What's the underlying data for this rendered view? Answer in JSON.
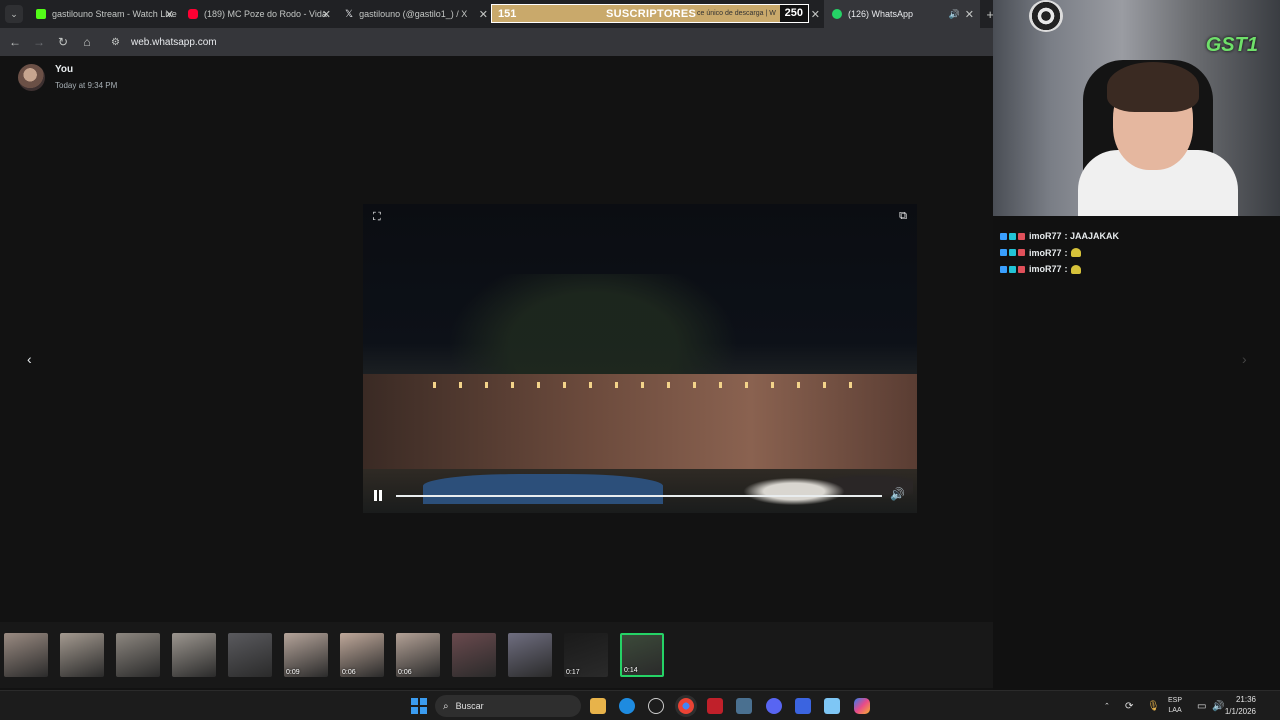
{
  "tabs": [
    {
      "title": "gastilouno Stream - Watch Live",
      "fav_color": "#53fc18",
      "active": false
    },
    {
      "title": "(189) MC Poze do Rodo - Vida",
      "fav_color": "#ff0033",
      "active": false
    },
    {
      "title": "gastilouno (@gastilo1_) / X",
      "fav_color": "#000000",
      "active": false
    },
    {
      "title": "Mensaje único de descarga | WhatsApp",
      "active": false
    },
    {
      "title": "(126) WhatsApp",
      "fav_color": "#25d366",
      "active": true
    }
  ],
  "overlay": {
    "current": "151",
    "label": "SUSCRIPTORES",
    "goal": "250",
    "under_text": "ce único de descarga | W"
  },
  "address": {
    "url": "web.whatsapp.com"
  },
  "viewer": {
    "sender_name": "You",
    "sender_time": "Today at 9:34 PM",
    "prev_label": "‹",
    "next_label": "›",
    "progress": 0.0
  },
  "thumbnails": [
    {
      "duration": "",
      "kind": "image",
      "color": "#9a8b82"
    },
    {
      "duration": "",
      "kind": "image",
      "color": "#a49a90"
    },
    {
      "duration": "",
      "kind": "image",
      "color": "#8d8780"
    },
    {
      "duration": "",
      "kind": "image",
      "color": "#9c968f"
    },
    {
      "duration": "",
      "kind": "image",
      "color": "#5a5a5e"
    },
    {
      "duration": "0:09",
      "kind": "video",
      "color": "#b5a49a"
    },
    {
      "duration": "0:06",
      "kind": "video",
      "color": "#bfa89a"
    },
    {
      "duration": "0:06",
      "kind": "video",
      "color": "#b3a196"
    },
    {
      "duration": "",
      "kind": "image",
      "color": "#6a4a4e"
    },
    {
      "duration": "",
      "kind": "image",
      "color": "#6f6e80"
    },
    {
      "duration": "0:17",
      "kind": "video",
      "color": "#1a1a1a"
    },
    {
      "duration": "0:14",
      "kind": "video",
      "color": "#3c4a3a",
      "selected": true
    }
  ],
  "webcam": {
    "logo": "GST1"
  },
  "chat": [
    {
      "user": "imoR77",
      "text": ": JAAJAKAK",
      "emote": false
    },
    {
      "user": "imoR77",
      "text": ":",
      "emote": true
    },
    {
      "user": "imoR77",
      "text": ":",
      "emote": true
    }
  ],
  "taskbar": {
    "search_placeholder": "Buscar",
    "lang_top": "ESP",
    "lang_bottom": "LAA",
    "time": "21:36",
    "date": "1/1/2026"
  }
}
